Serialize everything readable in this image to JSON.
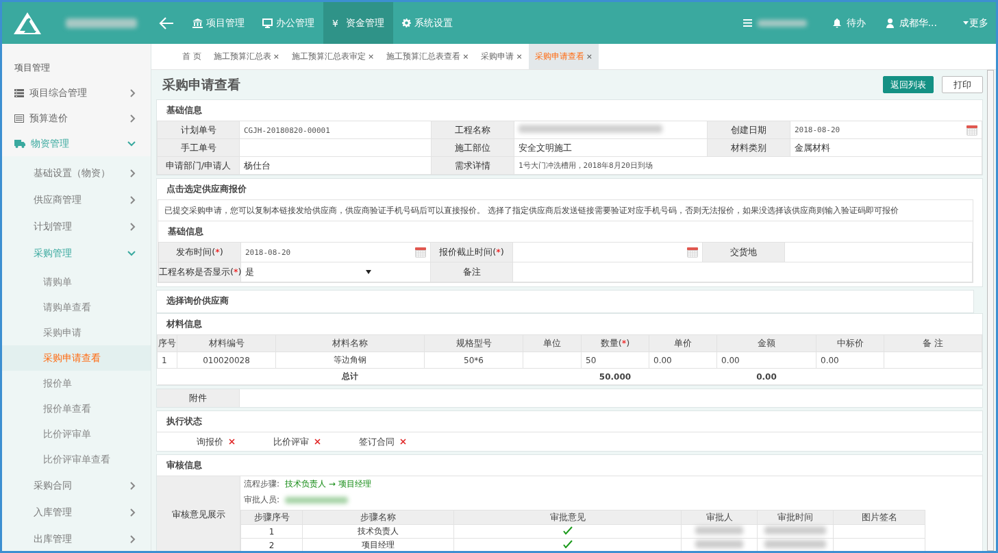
{
  "header": {
    "nav": [
      {
        "label": "项目管理",
        "selected": false
      },
      {
        "label": "办公管理",
        "selected": false
      },
      {
        "label": "资金管理",
        "symbol": "¥",
        "selected": true
      },
      {
        "label": "系统设置",
        "selected": false
      }
    ],
    "todo": "待办",
    "user": "成都华...",
    "more": "更多"
  },
  "sidebar": {
    "heading": "项目管理",
    "items": [
      {
        "label": "项目综合管理",
        "expanded": false
      },
      {
        "label": "预算造价",
        "expanded": false
      },
      {
        "label": "物资管理",
        "expanded": true,
        "children": [
          {
            "label": "基础设置（物资）",
            "expanded": false
          },
          {
            "label": "供应商管理",
            "expanded": false
          },
          {
            "label": "计划管理",
            "expanded": false
          },
          {
            "label": "采购管理",
            "expanded": true,
            "children": [
              {
                "label": "请购单",
                "selected": false
              },
              {
                "label": "请购单查看",
                "selected": false
              },
              {
                "label": "采购申请",
                "selected": false
              },
              {
                "label": "采购申请查看",
                "selected": true
              },
              {
                "label": "报价单",
                "selected": false
              },
              {
                "label": "报价单查看",
                "selected": false
              },
              {
                "label": "比价评审单",
                "selected": false
              },
              {
                "label": "比价评审单查看",
                "selected": false
              }
            ]
          },
          {
            "label": "采购合同",
            "expanded": false
          },
          {
            "label": "入库管理",
            "expanded": false
          },
          {
            "label": "出库管理",
            "expanded": false
          }
        ]
      }
    ]
  },
  "tabs": [
    {
      "label": "首 页",
      "selected": false
    },
    {
      "label": "施工预算汇总表",
      "close": "×",
      "selected": false
    },
    {
      "label": "施工预算汇总表审定",
      "close": "×",
      "selected": false
    },
    {
      "label": "施工预算汇总表查看",
      "close": "×",
      "selected": false
    },
    {
      "label": "采购申请",
      "close": "×",
      "selected": false
    },
    {
      "label": "采购申请查看",
      "close": "×",
      "selected": true
    }
  ],
  "page": {
    "title": "采购申请查看",
    "buttons": [
      {
        "label": "返回列表",
        "kind": "primary"
      },
      {
        "label": "打印",
        "kind": "default"
      }
    ]
  },
  "basic_info": {
    "title": "基础信息",
    "rows": [
      [
        {
          "label": "计划单号",
          "value": "CGJH-20180820-00001",
          "kind": "code"
        },
        {
          "label": "工程名称",
          "kind": "redacted"
        },
        {
          "label": "创建日期",
          "value": "2018-08-20",
          "kind": "date"
        }
      ],
      [
        {
          "label": "手工单号",
          "kind": "text"
        },
        {
          "label": "施工部位",
          "value": "安全文明施工",
          "kind": "text"
        },
        {
          "label": "材料类别",
          "value": "金属材料",
          "kind": "text"
        }
      ],
      [
        {
          "label": "申请部门/申请人",
          "value": "杨仕台",
          "kind": "text"
        },
        {
          "label": "需求详情",
          "value": "1号大门冲洗槽用，2018年8月20日到场",
          "kind": "code"
        }
      ]
    ]
  },
  "supplier_quote": {
    "title": "点击选定供应商报价",
    "notice": "已提交采购申请，您可以复制本链接发给供应商，供应商验证手机号码后可以直接报价。 选择了指定供应商后发送链接需要验证对应手机号码，否则无法报价，如果没选择该供应商则输入验证码即可报价",
    "subtitle": "基础信息",
    "rows": [
      [
        {
          "label": "发布时间",
          "mark": "(*)",
          "value": "2018-08-20",
          "kind": "date"
        },
        {
          "label": "报价截止时间",
          "mark": "(*)",
          "kind": "date"
        },
        {
          "label": "交货地",
          "kind": "text"
        }
      ],
      [
        {
          "label": "工程名称是否显示",
          "mark": "(*)",
          "value": "是",
          "kind": "select"
        },
        {
          "label": "备注",
          "kind": "text"
        }
      ]
    ]
  },
  "inquiry_suppliers": {
    "title": "选择询价供应商"
  },
  "materials": {
    "title": "材料信息",
    "columns": [
      {
        "label": "序号"
      },
      {
        "label": "材料编号"
      },
      {
        "label": "材料名称"
      },
      {
        "label": "规格型号"
      },
      {
        "label": "单位"
      },
      {
        "label": "数量",
        "mark": "(*)"
      },
      {
        "label": "单价"
      },
      {
        "label": "金额"
      },
      {
        "label": "中标价"
      },
      {
        "label": "备 注"
      }
    ],
    "rows": [
      [
        "1",
        "010020028",
        "等边角钢",
        "50*6",
        null,
        "50",
        "0.00",
        "0.00",
        "0.00",
        null
      ]
    ],
    "total": {
      "label": "总计",
      "quantity": "50.000",
      "amount": "0.00"
    }
  },
  "attachment": {
    "label": "附件"
  },
  "execution": {
    "title": "执行状态",
    "items": [
      {
        "label": "询报价",
        "done": false
      },
      {
        "label": "比价评审",
        "done": false
      },
      {
        "label": "签订合同",
        "done": false
      }
    ]
  },
  "review": {
    "title": "审核信息",
    "label": "审核意见展示",
    "flow_label": "流程步骤:",
    "flow": "技术负责人 → 项目经理",
    "approvers_label": "审批人员:",
    "columns": [
      "步骤序号",
      "步骤名称",
      "审批意见",
      "审批人",
      "审批时间",
      "图片签名"
    ],
    "rows": [
      {
        "no": "1",
        "name": "技术负责人",
        "approved": true
      },
      {
        "no": "2",
        "name": "项目经理",
        "approved": true
      }
    ]
  }
}
